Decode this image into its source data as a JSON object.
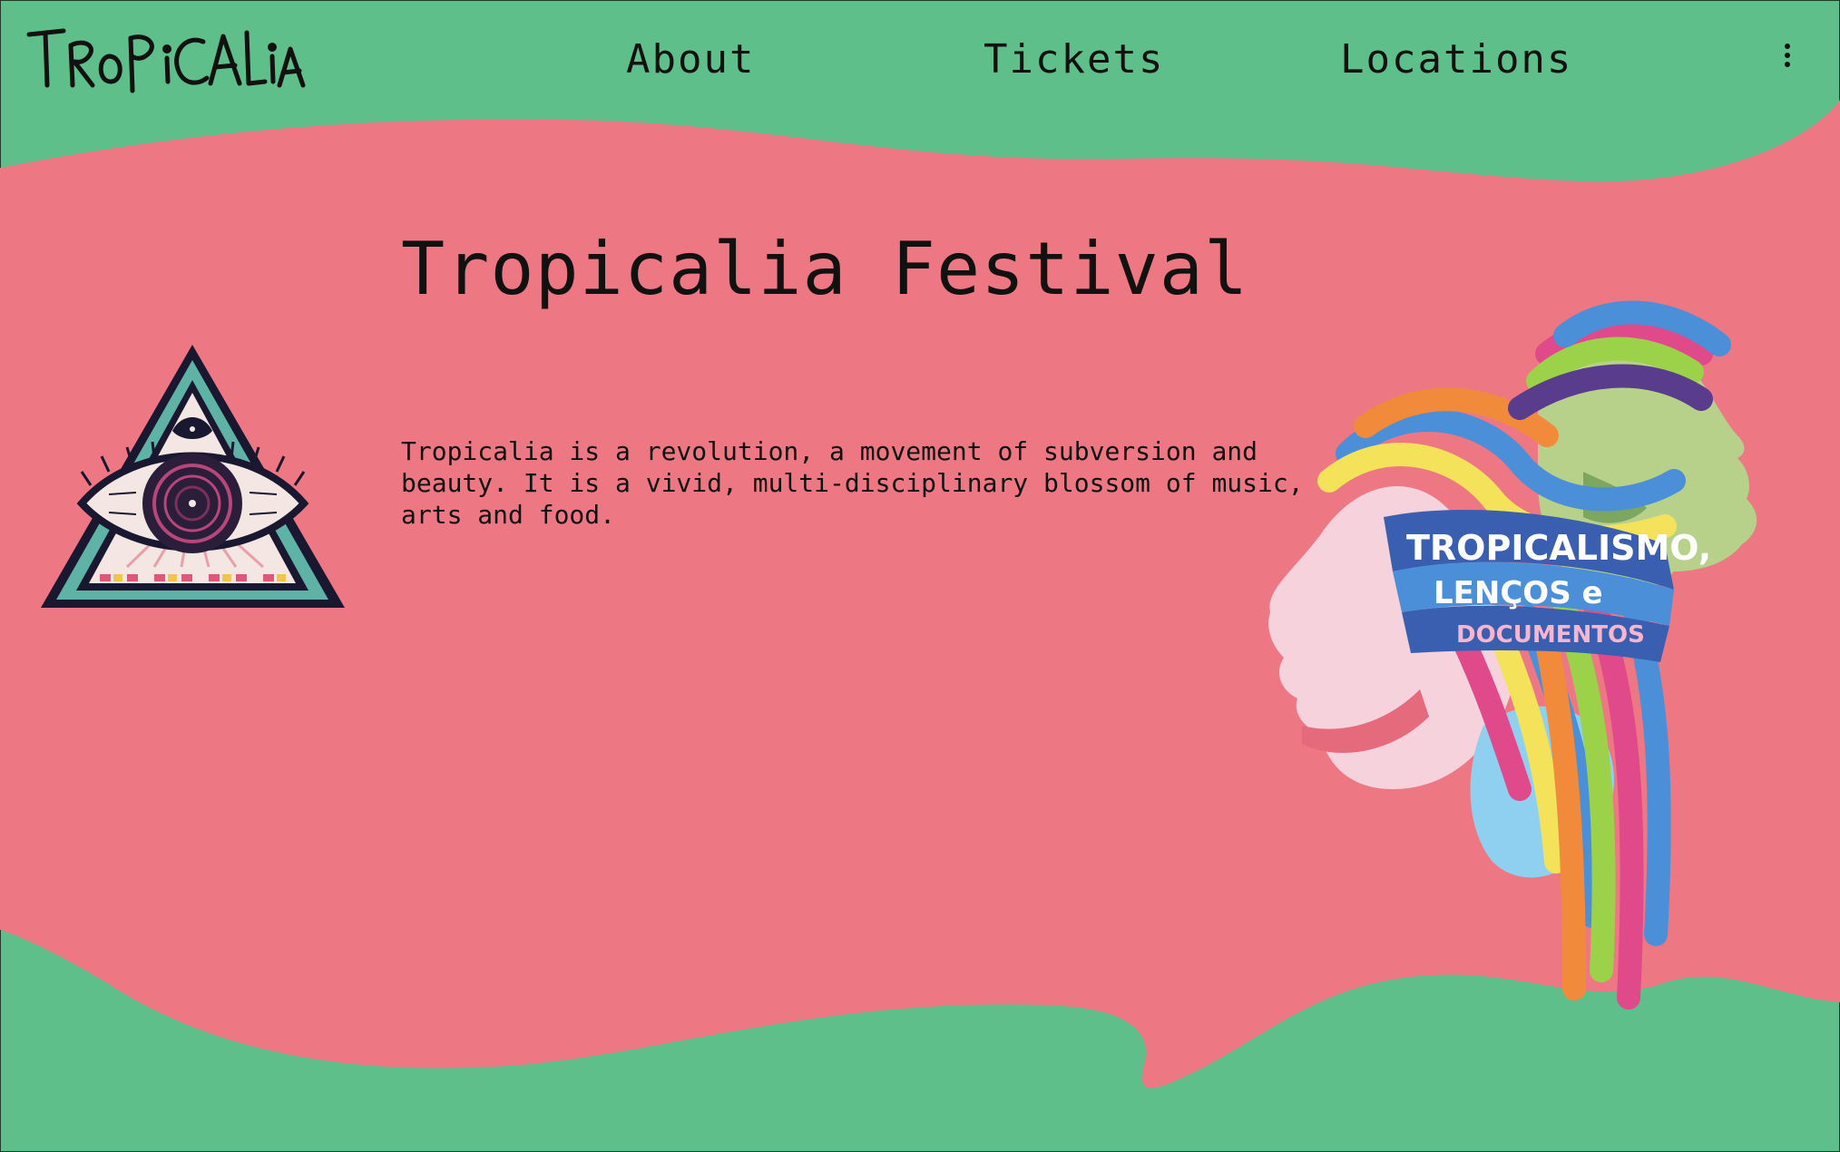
{
  "brand": {
    "logo_text": "TROPICALIA"
  },
  "nav": {
    "about": "About",
    "tickets": "Tickets",
    "locations": "Locations"
  },
  "hero": {
    "title": "Tropicalia Festival",
    "description": "Tropicalia is a revolution, a movement of subversion and beauty. It is a vivid, multi-disciplinary blossom of music, arts and food.",
    "art_banner_lines": [
      "TROPICALISMO,",
      "LENÇOS e",
      "DOCUMENTOS"
    ]
  },
  "colors": {
    "green": "#5fbf8a",
    "pink": "#ed7783",
    "ink": "#111111"
  },
  "icons": {
    "menu": "kebab-menu-icon",
    "eye": "all-seeing-eye-triangle",
    "heads": "colorful-heads-illustration"
  }
}
